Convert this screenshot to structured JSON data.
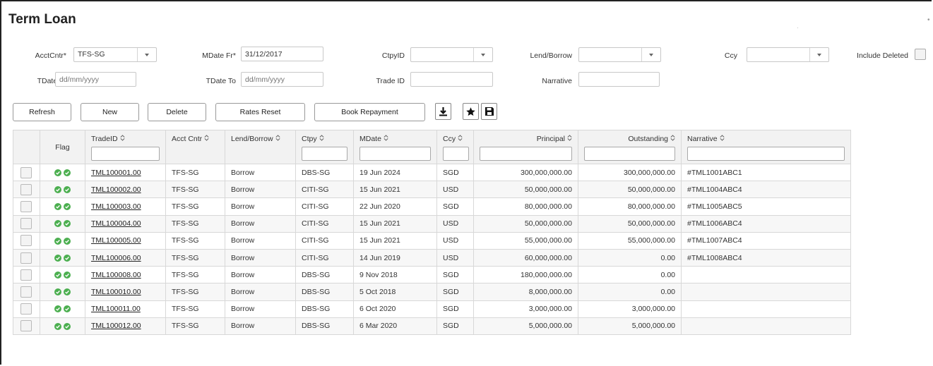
{
  "title": "Term Loan",
  "filters": {
    "acct_cntr": {
      "label": "AcctCntr*",
      "value": "TFS-SG"
    },
    "mdate_fr": {
      "label": "MDate Fr*",
      "value": "31/12/2017"
    },
    "ctpy_id": {
      "label": "CtpyID",
      "value": ""
    },
    "lend_borrow": {
      "label": "Lend/Borrow",
      "value": ""
    },
    "ccy": {
      "label": "Ccy",
      "value": ""
    },
    "include_deleted": {
      "label": "Include Deleted"
    },
    "tdate_fr": {
      "label": "TDate Fr",
      "placeholder": "dd/mm/yyyy"
    },
    "tdate_to": {
      "label": "TDate To",
      "placeholder": "dd/mm/yyyy"
    },
    "trade_id": {
      "label": "Trade ID",
      "value": ""
    },
    "narrative": {
      "label": "Narrative",
      "value": ""
    }
  },
  "toolbar": {
    "refresh": "Refresh",
    "new": "New",
    "delete": "Delete",
    "rates_reset": "Rates Reset",
    "book_repayment": "Book Repayment"
  },
  "icons": {
    "download": "download-icon",
    "star": "star-icon",
    "save": "save-icon",
    "flag": "check-circle-icon"
  },
  "colors": {
    "flag_green": "#4caf50",
    "grid_border": "#d8d8d8"
  },
  "columns": [
    "Flag",
    "TradeID",
    "Acct Cntr",
    "Lend/Borrow",
    "Ctpy",
    "MDate",
    "Ccy",
    "Principal",
    "Outstanding",
    "Narrative"
  ],
  "rows": [
    [
      "TML100001.00",
      "TFS-SG",
      "Borrow",
      "DBS-SG",
      "19 Jun 2024",
      "SGD",
      "300,000,000.00",
      "300,000,000.00",
      "#TML1001ABC1"
    ],
    [
      "TML100002.00",
      "TFS-SG",
      "Borrow",
      "CITI-SG",
      "15 Jun 2021",
      "USD",
      "50,000,000.00",
      "50,000,000.00",
      "#TML1004ABC4"
    ],
    [
      "TML100003.00",
      "TFS-SG",
      "Borrow",
      "CITI-SG",
      "22 Jun 2020",
      "SGD",
      "80,000,000.00",
      "80,000,000.00",
      "#TML1005ABC5"
    ],
    [
      "TML100004.00",
      "TFS-SG",
      "Borrow",
      "CITI-SG",
      "15 Jun 2021",
      "USD",
      "50,000,000.00",
      "50,000,000.00",
      "#TML1006ABC4"
    ],
    [
      "TML100005.00",
      "TFS-SG",
      "Borrow",
      "CITI-SG",
      "15 Jun 2021",
      "USD",
      "55,000,000.00",
      "55,000,000.00",
      "#TML1007ABC4"
    ],
    [
      "TML100006.00",
      "TFS-SG",
      "Borrow",
      "CITI-SG",
      "14 Jun 2019",
      "USD",
      "60,000,000.00",
      "0.00",
      "#TML1008ABC4"
    ],
    [
      "TML100008.00",
      "TFS-SG",
      "Borrow",
      "DBS-SG",
      "9 Nov 2018",
      "SGD",
      "180,000,000.00",
      "0.00",
      ""
    ],
    [
      "TML100010.00",
      "TFS-SG",
      "Borrow",
      "DBS-SG",
      "5 Oct 2018",
      "SGD",
      "8,000,000.00",
      "0.00",
      ""
    ],
    [
      "TML100011.00",
      "TFS-SG",
      "Borrow",
      "DBS-SG",
      "6 Oct 2020",
      "SGD",
      "3,000,000.00",
      "3,000,000.00",
      ""
    ],
    [
      "TML100012.00",
      "TFS-SG",
      "Borrow",
      "DBS-SG",
      "6 Mar 2020",
      "SGD",
      "5,000,000.00",
      "5,000,000.00",
      ""
    ]
  ]
}
